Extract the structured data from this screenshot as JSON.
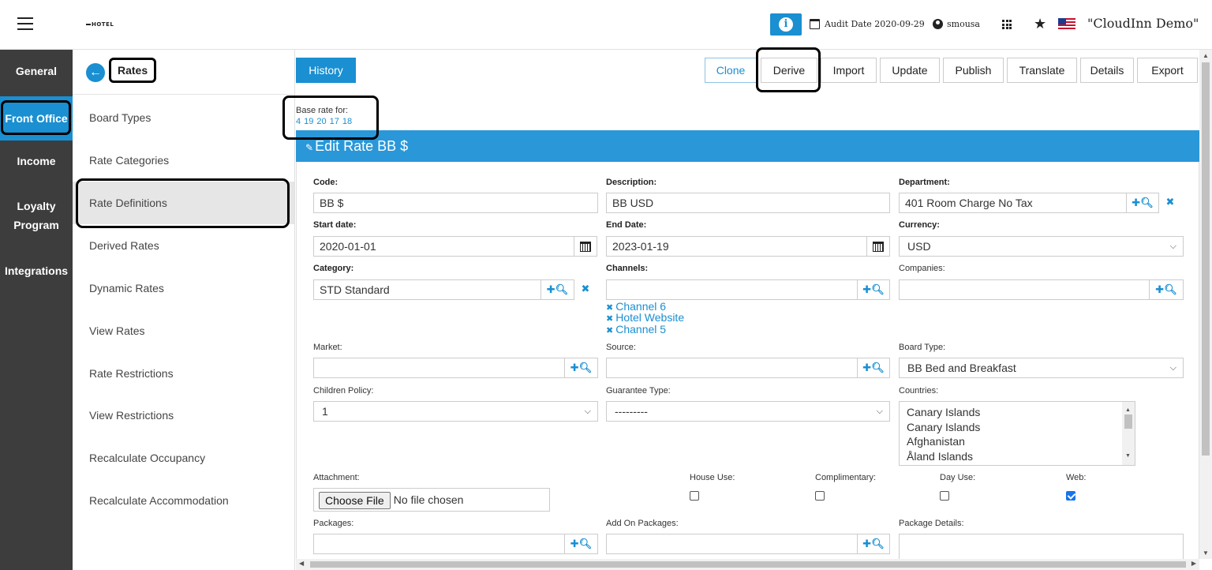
{
  "header": {
    "logo_text": "HOTEL",
    "audit_date": "Audit Date 2020-09-29",
    "username": "smousa",
    "hotel_name": "\"CloudInn Demo\""
  },
  "leftnav": {
    "items": [
      {
        "label": "General"
      },
      {
        "label": "Front Office",
        "active": true
      },
      {
        "label": "Income"
      },
      {
        "label": "Loyalty Program"
      },
      {
        "label": "Integrations"
      }
    ]
  },
  "subnav": {
    "title": "Rates",
    "items": [
      {
        "label": "Board Types"
      },
      {
        "label": "Rate Categories"
      },
      {
        "label": "Rate Definitions",
        "active": true
      },
      {
        "label": "Derived Rates"
      },
      {
        "label": "Dynamic Rates"
      },
      {
        "label": "View Rates"
      },
      {
        "label": "Rate Restrictions"
      },
      {
        "label": "View Restrictions"
      },
      {
        "label": "Recalculate Occupancy"
      },
      {
        "label": "Recalculate Accommodation"
      }
    ]
  },
  "toolbar": {
    "history": "History",
    "buttons": [
      "Clone",
      "Derive",
      "Import",
      "Update",
      "Publish",
      "Translate",
      "Details",
      "Export"
    ]
  },
  "base_rate": {
    "label": "Base rate for:",
    "links": [
      "4",
      "19",
      "20",
      "17",
      "18"
    ]
  },
  "form": {
    "title": "Edit Rate BB $",
    "code_label": "Code:",
    "code_value": "BB $",
    "description_label": "Description:",
    "description_value": "BB USD",
    "department_label": "Department:",
    "department_value": "401 Room Charge No Tax",
    "start_label": "Start date:",
    "start_value": "2020-01-01",
    "end_label": "End Date:",
    "end_value": "2023-01-19",
    "currency_label": "Currency:",
    "currency_value": "USD",
    "category_label": "Category:",
    "category_value": "STD Standard",
    "channels_label": "Channels:",
    "channels": [
      "Channel 6",
      "Hotel Website",
      "Channel 5"
    ],
    "companies_label": "Companies:",
    "market_label": "Market:",
    "source_label": "Source:",
    "board_label": "Board Type:",
    "board_value": "BB Bed and Breakfast",
    "children_label": "Children Policy:",
    "children_value": "1",
    "guarantee_label": "Guarantee Type:",
    "guarantee_value": "---------",
    "countries_label": "Countries:",
    "countries": [
      "Canary Islands",
      "Canary Islands",
      "Afghanistan",
      "Åland Islands"
    ],
    "attachment_label": "Attachment:",
    "file_button": "Choose File",
    "file_status": "No file chosen",
    "house_use_label": "House Use:",
    "complimentary_label": "Complimentary:",
    "day_use_label": "Day Use:",
    "web_label": "Web:",
    "house_use": false,
    "complimentary": false,
    "day_use": false,
    "web": true,
    "packages_label": "Packages:",
    "addon_packages_label": "Add On Packages:",
    "package_details_label": "Package Details:"
  },
  "colors": {
    "accent": "#1a8fd1",
    "nav_bg": "#3d3d3d",
    "panel_head": "#2a97d8"
  }
}
